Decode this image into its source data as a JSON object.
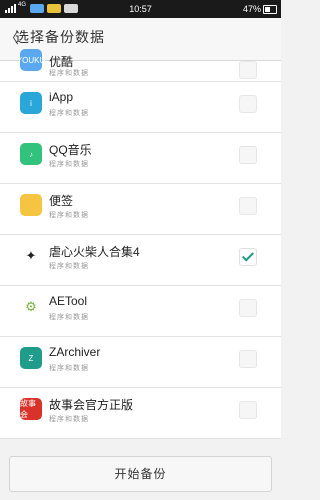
{
  "status_bar": {
    "network": "4G",
    "time": "10:57",
    "battery": "47%"
  },
  "header": {
    "back_symbol": "〈",
    "title": "选择备份数据"
  },
  "apps": [
    {
      "name": "优酷",
      "sub": "程序和数据",
      "checked": false,
      "icon": "youku-icon",
      "icon_color": "#5aa9f0",
      "icon_text": "YOUKU"
    },
    {
      "name": "iApp",
      "sub": "程序和数据",
      "checked": false,
      "icon": "iapp-icon",
      "icon_color": "#2aa6d9",
      "icon_text": "i"
    },
    {
      "name": "QQ音乐",
      "sub": "程序和数据",
      "checked": false,
      "icon": "qqmusic-icon",
      "icon_color": "#31c27c",
      "icon_text": "♪"
    },
    {
      "name": "便签",
      "sub": "程序和数据",
      "checked": false,
      "icon": "notes-icon",
      "icon_color": "#f5c542",
      "icon_text": ""
    },
    {
      "name": "虐心火柴人合集4",
      "sub": "程序和数据",
      "checked": true,
      "icon": "stickman-icon",
      "icon_color": "#ffffff",
      "icon_text": "✦"
    },
    {
      "name": "AETool",
      "sub": "程序和数据",
      "checked": false,
      "icon": "android-icon",
      "icon_color": "#ffffff",
      "icon_text": "⚙"
    },
    {
      "name": "ZArchiver",
      "sub": "程序和数据",
      "checked": false,
      "icon": "zarchiver-icon",
      "icon_color": "#1f9c8a",
      "icon_text": "Z"
    },
    {
      "name": "故事会官方正版",
      "sub": "程序和数据",
      "checked": false,
      "icon": "storybook-icon",
      "icon_color": "#d8322b",
      "icon_text": "故事会"
    }
  ],
  "footer": {
    "start_button": "开始备份"
  },
  "colors": {
    "accent": "#1a9b84",
    "header_bg": "#f7f7f7",
    "status_bg": "#1a1a1a"
  }
}
